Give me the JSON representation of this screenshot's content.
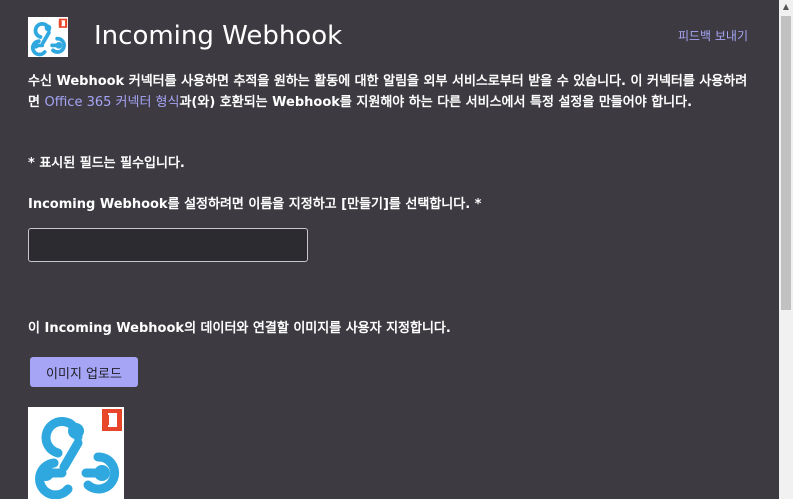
{
  "header": {
    "title": "Incoming Webhook",
    "feedback_link": "피드백 보내기",
    "logo_icon": "webhook-logo-icon"
  },
  "description": {
    "part1": "수신 Webhook 커넥터를 사용하면 추적을 원하는 활동에 대한 알림을 외부 서비스로부터 받을 수 있습니다. 이 커넥터를 사용하려면 ",
    "link_text": "Office 365 커넥터 형식",
    "part2": "과(와) 호환되는 Webhook를 지원해야 하는 다른 서비스에서 특정 설정을 만들어야 합니다."
  },
  "required_note": "* 표시된 필드는 필수입니다.",
  "name_field": {
    "label": "Incoming Webhook를 설정하려면 이름을 지정하고 [만들기]를 선택합니다. *",
    "value": "",
    "placeholder": ""
  },
  "image_section": {
    "label": "이 Incoming Webhook의 데이터와 연결할 이미지를 사용자 지정합니다.",
    "upload_button": "이미지 업로드",
    "preview_icon": "webhook-logo-icon"
  },
  "colors": {
    "background": "#3d3b41",
    "accent": "#a5a4f5",
    "webhook_blue": "#2fa8e0",
    "office_red": "#e8462a"
  }
}
